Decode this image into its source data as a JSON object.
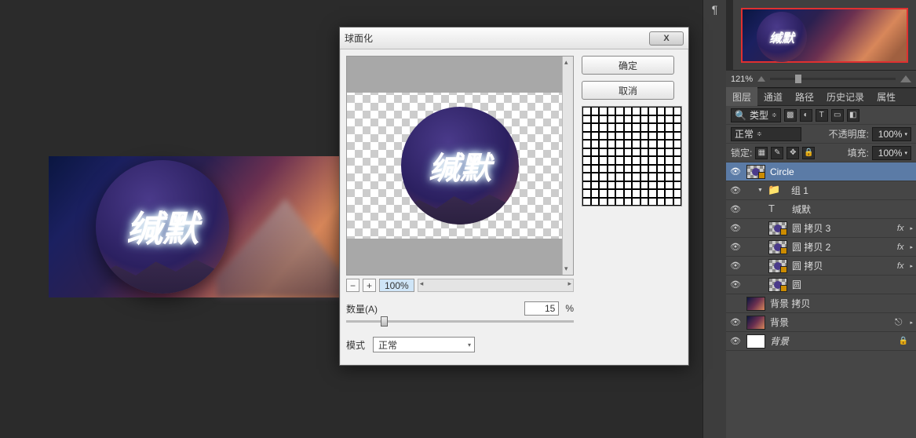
{
  "canvas": {
    "text": "缄默"
  },
  "dialog": {
    "title": "球面化",
    "ok": "确定",
    "cancel": "取消",
    "zoom": "100%",
    "amount_label": "数量(A)",
    "amount_value": "15",
    "amount_unit": "%",
    "mode_label": "模式",
    "mode_value": "正常",
    "preview_text": "缄默"
  },
  "navigator": {
    "thumb_text": "缄默",
    "zoom": "121%"
  },
  "panel": {
    "tabs": [
      "图层",
      "通道",
      "路径",
      "历史记录",
      "属性"
    ],
    "kind_label": "类型",
    "blend_mode": "正常",
    "opacity_label": "不透明度:",
    "opacity_value": "100%",
    "lock_label": "锁定:",
    "fill_label": "填充:",
    "fill_value": "100%",
    "search_icon": "🔍"
  },
  "layers": [
    {
      "id": "circle",
      "name": "Circle",
      "type": "smartobject",
      "selected": true,
      "visible": true,
      "indent": 0,
      "fx": false,
      "lock": false
    },
    {
      "id": "group1",
      "name": "组 1",
      "type": "folder",
      "selected": false,
      "visible": true,
      "indent": 1,
      "fx": false,
      "lock": false,
      "twisty": "▼"
    },
    {
      "id": "text1",
      "name": "缄默",
      "type": "text",
      "selected": false,
      "visible": true,
      "indent": 2,
      "fx": false,
      "lock": false
    },
    {
      "id": "copy3",
      "name": "圆 拷贝 3",
      "type": "smartobject",
      "selected": false,
      "visible": true,
      "indent": 2,
      "fx": true,
      "lock": false
    },
    {
      "id": "copy2",
      "name": "圆 拷贝 2",
      "type": "smartobject",
      "selected": false,
      "visible": true,
      "indent": 2,
      "fx": true,
      "lock": false
    },
    {
      "id": "copy1",
      "name": "圆 拷贝",
      "type": "smartobject",
      "selected": false,
      "visible": true,
      "indent": 2,
      "fx": true,
      "lock": false
    },
    {
      "id": "yuan",
      "name": "圆",
      "type": "smartobject",
      "selected": false,
      "visible": true,
      "indent": 2,
      "fx": false,
      "lock": false
    },
    {
      "id": "bgcopy",
      "name": "背景 拷贝",
      "type": "raster",
      "selected": false,
      "visible": false,
      "indent": 0,
      "fx": false,
      "lock": false
    },
    {
      "id": "bg",
      "name": "背景",
      "type": "raster",
      "selected": false,
      "visible": true,
      "indent": 0,
      "fx": false,
      "lock": false,
      "link": true
    },
    {
      "id": "bgwhite",
      "name": "背景",
      "type": "white",
      "selected": false,
      "visible": true,
      "indent": 0,
      "fx": false,
      "lock": true,
      "italic": true
    }
  ],
  "fx_label": "fx"
}
